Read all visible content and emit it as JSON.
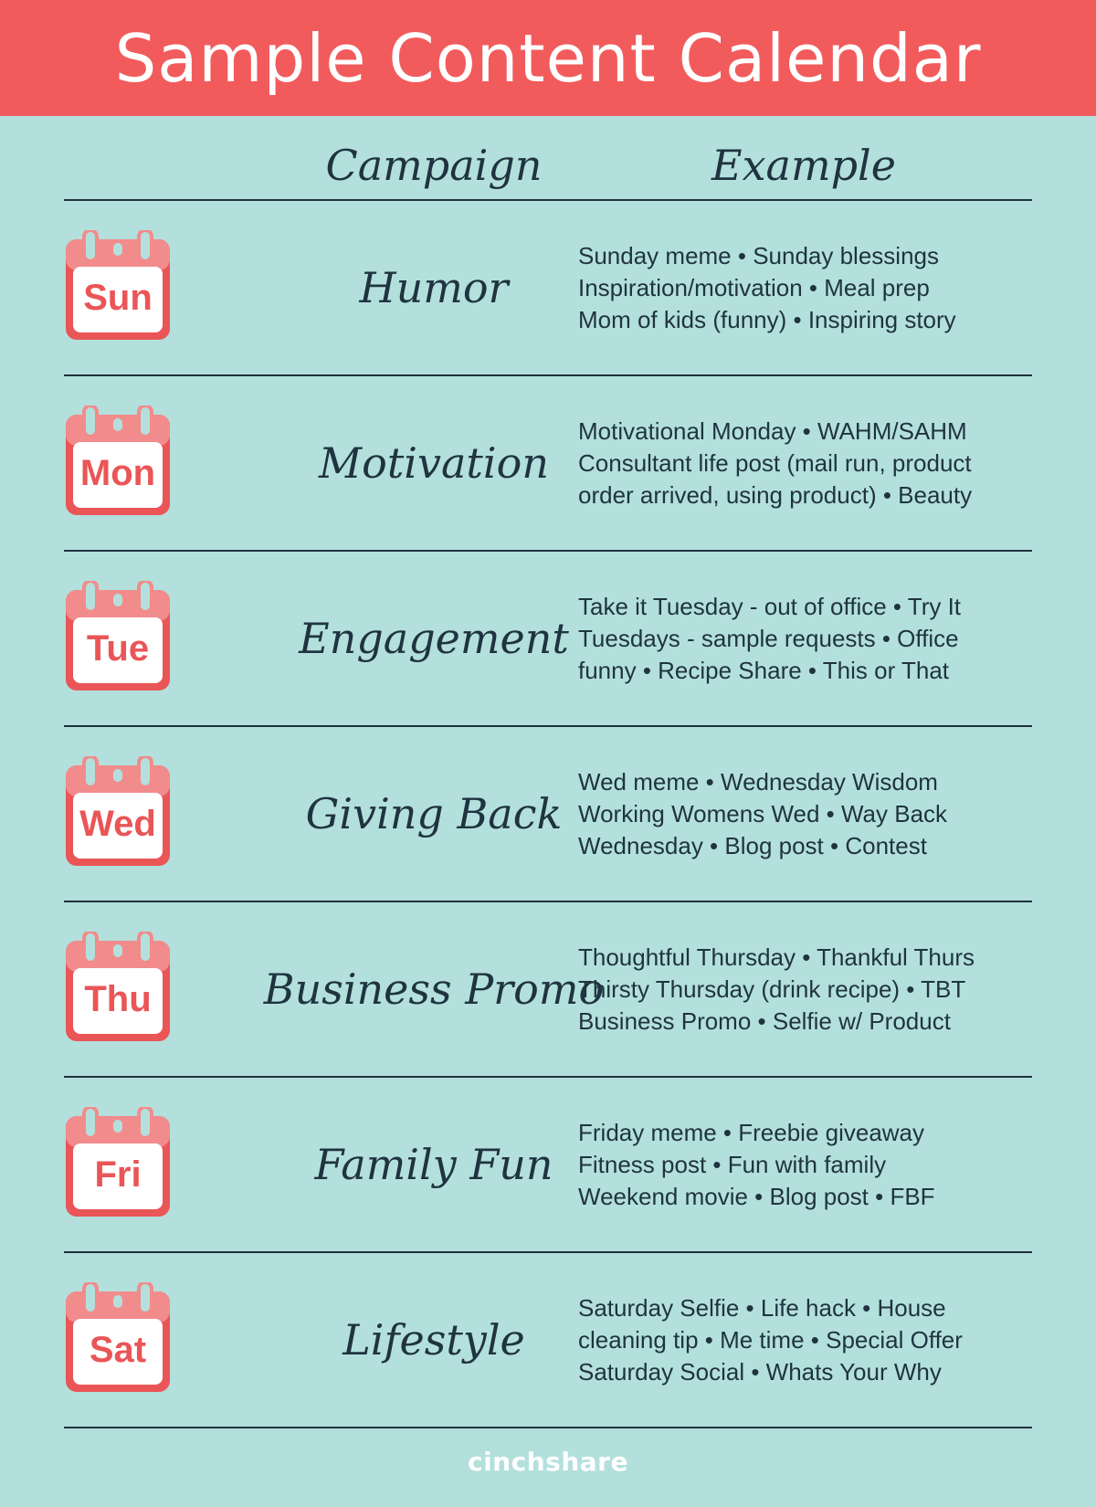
{
  "title": "Sample Content Calendar",
  "columns": {
    "campaign": "Campaign",
    "example": "Example"
  },
  "rows": [
    {
      "day": "Sun",
      "campaign": "Humor",
      "examples": [
        "Sunday meme • Sunday blessings",
        "Inspiration/motivation • Meal prep",
        "Mom of kids (funny) • Inspiring story"
      ]
    },
    {
      "day": "Mon",
      "campaign": "Motivation",
      "examples": [
        "Motivational Monday • WAHM/SAHM",
        "Consultant life post (mail run, product",
        "order arrived, using product) • Beauty"
      ]
    },
    {
      "day": "Tue",
      "campaign": "Engagement",
      "examples": [
        "Take it Tuesday - out of office • Try It",
        "Tuesdays - sample requests • Office",
        "funny • Recipe Share • This or That"
      ]
    },
    {
      "day": "Wed",
      "campaign": "Giving Back",
      "examples": [
        "Wed meme • Wednesday Wisdom",
        "Working Womens Wed • Way Back",
        "Wednesday • Blog post • Contest"
      ]
    },
    {
      "day": "Thu",
      "campaign": "Business Promo",
      "examples": [
        "Thoughtful Thursday • Thankful Thurs",
        "Thirsty Thursday (drink recipe) • TBT",
        "Business Promo • Selfie w/ Product"
      ]
    },
    {
      "day": "Fri",
      "campaign": "Family Fun",
      "examples": [
        "Friday meme • Freebie giveaway",
        "Fitness post • Fun with family",
        "Weekend movie • Blog post • FBF"
      ]
    },
    {
      "day": "Sat",
      "campaign": "Lifestyle",
      "examples": [
        "Saturday Selfie • Life hack • House",
        "cleaning tip • Me time • Special Offer",
        "Saturday Social • Whats Your Why"
      ]
    }
  ],
  "footer": {
    "brand": "cinchshare"
  },
  "colors": {
    "banner": "#f25b5c",
    "background": "#b3e0dc",
    "text": "#1f3340",
    "calendar": "#ea5557"
  },
  "icons": {
    "day": "calendar-icon"
  }
}
